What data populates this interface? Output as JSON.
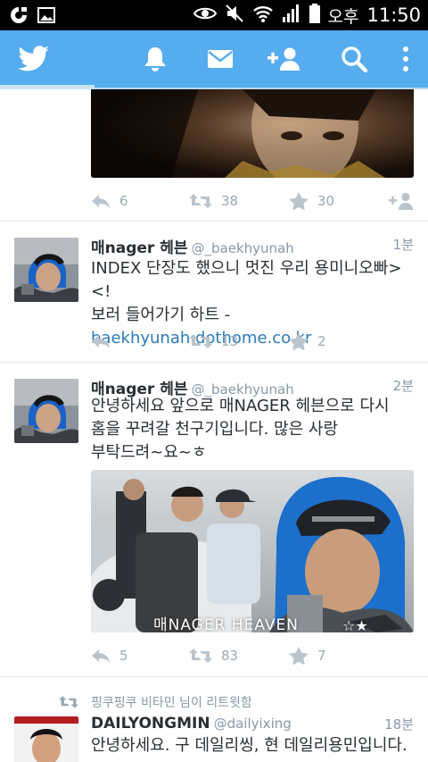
{
  "statusbar": {
    "ampm": "오후",
    "time": "11:50",
    "icons": [
      "app-icon",
      "gallery-icon",
      "eye-icon",
      "mute-icon",
      "wifi-icon",
      "signal-icon",
      "battery-icon"
    ]
  },
  "toolbar": {
    "icons": [
      "twitter-bird-icon",
      "notifications-bell-icon",
      "messages-envelope-icon",
      "add-user-icon",
      "search-icon",
      "overflow-menu-icon"
    ],
    "brand_color": "#55acee"
  },
  "tweets": [
    {
      "replies": "6",
      "retweets": "38",
      "favorites": "30"
    },
    {
      "name": "매nager 헤븐",
      "handle": "@_baekhyunah",
      "time": "1분",
      "text_line1": "INDEX 단장도 했으니 멋진 우리 용미니오빠><!",
      "text_line2": "보러 들어가기 하트 -",
      "link": "baekhyunah.dothome.co.kr",
      "replies": "",
      "retweets": "13",
      "favorites": "2"
    },
    {
      "name": "매nager 헤븐",
      "handle": "@_baekhyunah",
      "time": "2분",
      "text_line1": "안녕하세요 앞으로 매NAGER 헤븐으로 다시",
      "text_line2": "홈을 꾸려갈 천구기입니다. 많은 사랑",
      "text_line3": "부탁드려~요~ㅎ",
      "media_watermark": "매NAGER HEAVEN",
      "media_stars": "☆★",
      "replies": "5",
      "retweets": "83",
      "favorites": "7"
    },
    {
      "retweet_context": "핑쿠핑쿠 비타민 님이 리트윗함",
      "name": "DAILYONGMIN",
      "handle": "@dailyixing",
      "time": "18분",
      "text_line1": "안녕하세요. 구 데일리씽, 현 데일리용민입니다."
    }
  ]
}
